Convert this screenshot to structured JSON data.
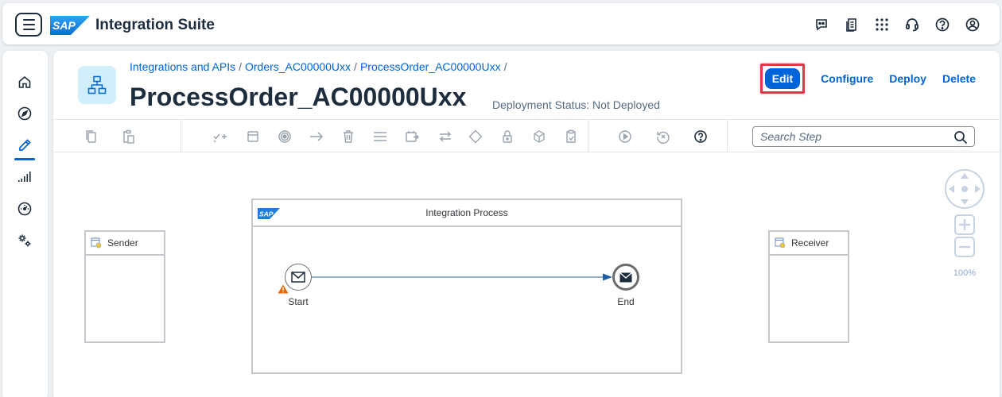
{
  "shell": {
    "menu_icon": "hamburger-icon",
    "logo_text": "SAP",
    "title": "Integration Suite",
    "actions": [
      "joule-icon",
      "notes-icon",
      "product-switch-icon",
      "support-icon",
      "help-icon",
      "profile-icon"
    ]
  },
  "nav": {
    "items": [
      "home-icon",
      "discover-icon",
      "design-icon",
      "monitor-icon",
      "settings-dial-icon",
      "configure-icon"
    ],
    "active": "design-icon"
  },
  "header": {
    "breadcrumb": [
      "Integrations and APIs",
      "Orders_AC00000Uxx",
      "ProcessOrder_AC00000Uxx"
    ],
    "title": "ProcessOrder_AC00000Uxx",
    "deployment_status": "Deployment Status: Not Deployed",
    "actions": {
      "edit": "Edit",
      "configure": "Configure",
      "deploy": "Deploy",
      "delete": "Delete"
    }
  },
  "toolbar": {
    "search_placeholder": "Search Step",
    "icons": [
      "copy-icon",
      "paste-icon",
      "add-check-icon",
      "participant-icon",
      "event-icon",
      "flow-arrow-icon",
      "delete-icon",
      "lines-icon",
      "call-icon",
      "exchange-icon",
      "gateway-icon",
      "lock-icon",
      "cube-icon",
      "clipboard-icon",
      "simulate-icon",
      "reset-icon",
      "help-icon"
    ]
  },
  "diagram": {
    "sender_label": "Sender",
    "receiver_label": "Receiver",
    "process_title": "Integration Process",
    "start_label": "Start",
    "end_label": "End",
    "zoom_level": "100%"
  },
  "colors": {
    "accent": "#0064d9",
    "highlight": "#e0374b",
    "warning": "#e76500",
    "flow": "#5a7fa6"
  }
}
